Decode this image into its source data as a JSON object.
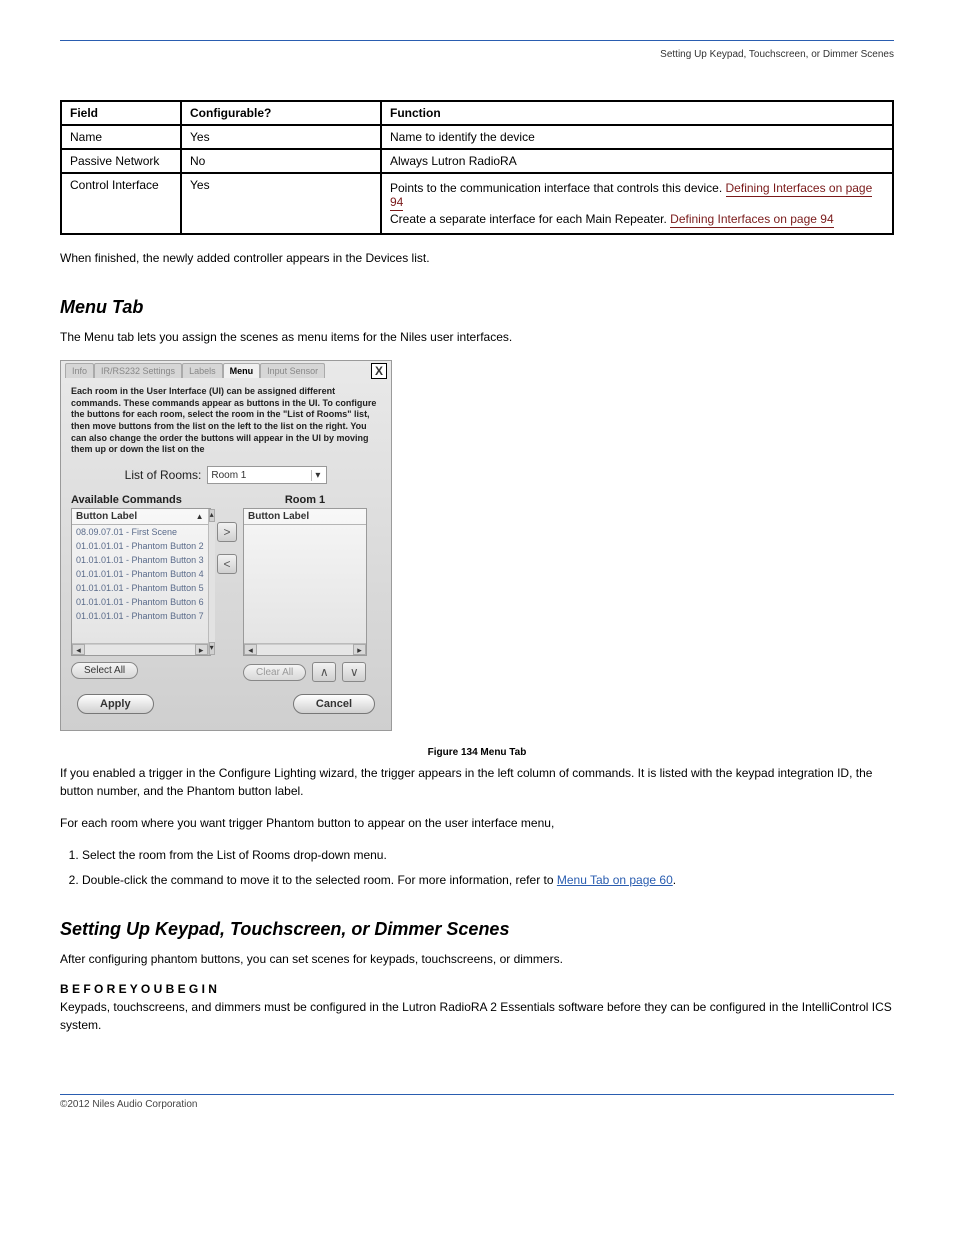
{
  "header": {
    "running": "Setting Up Keypad, Touchscreen, or Dimmer Scenes"
  },
  "table": {
    "headers": {
      "field": "Field",
      "config": "Configurable?",
      "function": "Function"
    },
    "rows": [
      {
        "field": "Name",
        "config": "Yes",
        "function": "Name to identify the device"
      },
      {
        "field": "Passive Network",
        "config": "No",
        "function": "Always Lutron RadioRA"
      },
      {
        "field": "Control Interface",
        "config": "Yes",
        "function_parts": [
          "Points to the communication interface that controls this device.",
          {
            "xref": "Defining Interfaces on page 94"
          },
          "Create a separate interface for each Main Repeater.",
          {
            "xref": "Defining Interfaces on page 94"
          }
        ]
      }
    ]
  },
  "intro": {
    "p": "When finished, the newly added controller appears in the Devices list."
  },
  "section2": {
    "title": "Menu Tab",
    "p": "The Menu tab lets you assign the scenes as menu items for the Niles user interfaces."
  },
  "ui": {
    "tabs": [
      "Info",
      "IR/RS232 Settings",
      "Labels",
      "Menu",
      "Input Sensor"
    ],
    "active_tab": "Menu",
    "close": "X",
    "desc": "Each room in the User Interface (UI) can be assigned different commands.  These commands appear as buttons in the UI.  To configure the buttons for each room, select the room in the \"List of Rooms\" list, then move buttons from the list on the left to the list on the right.  You can also change the order the buttons will appear in the UI by moving them up or down the list on the",
    "rooms_label": "List of Rooms:",
    "rooms_value": "Room 1",
    "left_title": "Available Commands",
    "right_title": "Room 1",
    "col_header": "Button Label",
    "items": [
      "08.09.07.01 - First Scene",
      "01.01.01.01 - Phantom Button 2",
      "01.01.01.01 - Phantom Button 3",
      "01.01.01.01 - Phantom Button 4",
      "01.01.01.01 - Phantom Button 5",
      "01.01.01.01 - Phantom Button 6",
      "01.01.01.01 - Phantom Button 7"
    ],
    "select_all": "Select All",
    "clear_all": "Clear All",
    "apply": "Apply",
    "cancel": "Cancel",
    "up": "∧",
    "down": "∨",
    "right_arrow": ">",
    "left_arrow": "<"
  },
  "figure": "Figure 134  Menu Tab",
  "below": {
    "p1": "If you enabled a trigger in the Configure Lighting wizard, the trigger appears in the left column of commands. It is listed with the keypad integration ID, the button number, and the Phantom button label.",
    "p2": "For each room where you want trigger Phantom button to appear on the user interface menu,"
  },
  "steps": [
    "Select the room from the List of Rooms drop-down menu.",
    {
      "pre": "Double-click the command to move it to the selected room. For more information, refer to ",
      "xref": "Menu Tab on page 60",
      "post": "."
    }
  ],
  "section3": {
    "title": "Setting Up Keypad, Touchscreen, or Dimmer Scenes",
    "p1": "After configuring phantom buttons, you can set scenes for keypads, touchscreens, or dimmers.",
    "note_head": "B E F O R E   Y O U   B E G I N",
    "note": "Keypads, touchscreens, and dimmers must be configured in the Lutron RadioRA 2 Essentials software before they can be configured in the IntelliControl ICS system."
  },
  "footer": "©2012 Niles Audio Corporation"
}
